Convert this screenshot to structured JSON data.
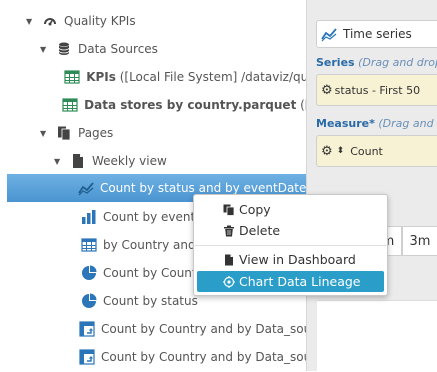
{
  "tree": {
    "root": {
      "label": "Quality KPIs",
      "icon": "dashboard-icon"
    },
    "data_sources": {
      "label": "Data Sources",
      "icon": "database-icon"
    },
    "sources": [
      {
        "bold": "KPIs",
        "rest": " ([Local File System] /dataviz/qua",
        "icon": "table-icon"
      },
      {
        "bold": "Data stores by country.parquet",
        "rest": " ([Lo",
        "icon": "table-icon"
      }
    ],
    "pages": {
      "label": "Pages",
      "icon": "pages-icon"
    },
    "weekly": {
      "label": "Weekly view",
      "icon": "page-icon"
    },
    "charts": [
      {
        "label": "Count by status and by eventDate (",
        "icon": "line-chart-icon",
        "selected": true
      },
      {
        "label": "Count by eventDa",
        "icon": "bar-chart-icon"
      },
      {
        "label": "by Country and",
        "icon": "table-icon"
      },
      {
        "label": "Count by Count",
        "icon": "pie-chart-icon"
      },
      {
        "label": "Count by status",
        "icon": "pie-chart-icon"
      },
      {
        "label": "Count by Country and by Data_sou",
        "icon": "pivot-icon"
      },
      {
        "label": "Count by Country and by Data_sou",
        "icon": "pivot-icon"
      }
    ]
  },
  "right": {
    "chart_type": "Time series",
    "series_label_bold": "Series",
    "series_label_hint": " (Drag and drop a",
    "series_chip": "status - First 50",
    "measure_label_bold": "Measure*",
    "measure_label_hint": " (Drag and dr",
    "measure_chip": "Count",
    "btn_m": "m",
    "btn_3m": "3m"
  },
  "context_menu": {
    "items": [
      {
        "label": "Copy",
        "icon": "copy-icon"
      },
      {
        "label": "Delete",
        "icon": "trash-icon"
      },
      {
        "label": "View in Dashboard",
        "icon": "page-icon"
      },
      {
        "label": "Chart Data Lineage",
        "icon": "lineage-icon",
        "active": true
      }
    ]
  },
  "colors": {
    "selection": "#4a94d1",
    "menu_active": "#2a9ec9",
    "chip_bg": "#f7f2d4",
    "label_blue": "#2a6aa8"
  }
}
